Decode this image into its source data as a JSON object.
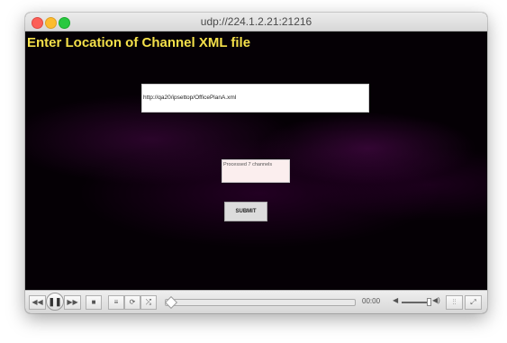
{
  "window": {
    "title": "udp://224.1.2.21:21216"
  },
  "content": {
    "heading": "Enter Location of Channel XML file",
    "url_value": "http://qa20/ipsettop/OfficePlanA.xml",
    "status": "Processed 7 channels",
    "submit_label": "SUBMIT"
  },
  "controls": {
    "rewind": "◀◀",
    "play_pause": "❚❚",
    "forward": "▶▶",
    "stop": "■",
    "playlist": "≡",
    "loop": "⟳",
    "shuffle": "⤮",
    "time": "00:00",
    "vol_low": "◀",
    "vol_high": "◀)",
    "equalizer": "⫶⫶",
    "fullscreen": "⤢"
  },
  "colors": {
    "heading": "#f4e04a",
    "video_bg": "#050005"
  }
}
